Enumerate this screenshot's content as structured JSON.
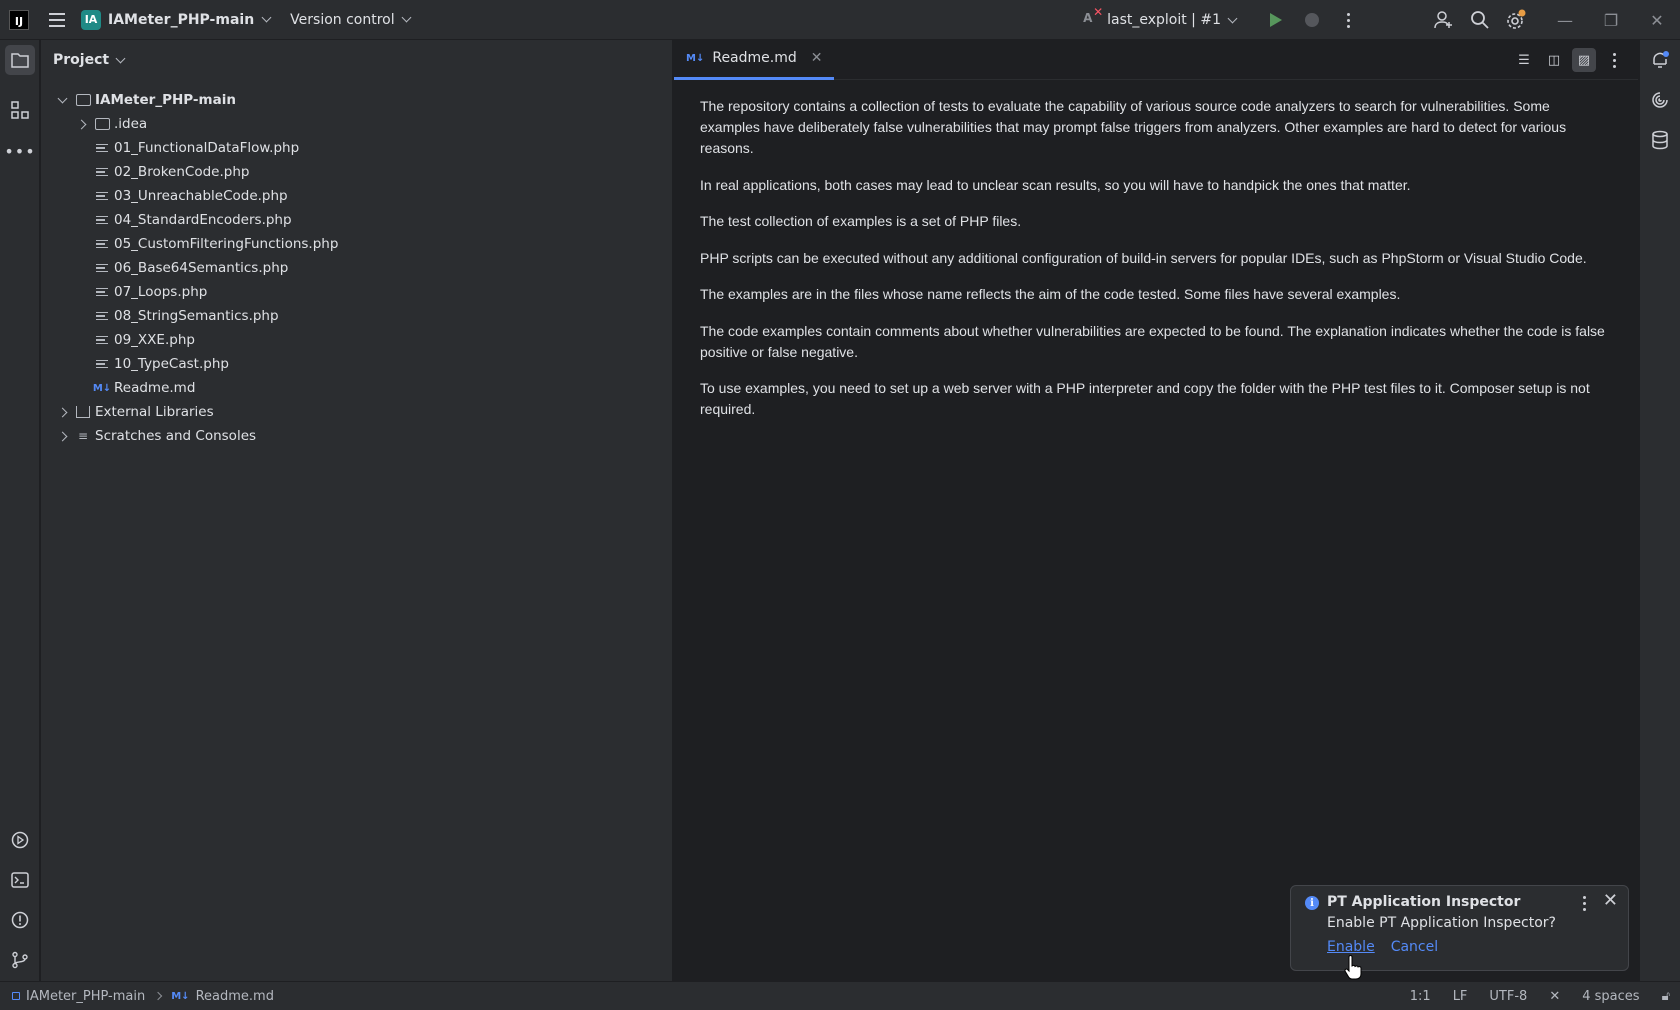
{
  "titlebar": {
    "logo": "IJ",
    "project_badge": "IA",
    "project_name": "IAMeter_PHP-main",
    "version_control": "Version control",
    "run_config": "last_exploit | #1"
  },
  "project_panel": {
    "title": "Project",
    "tree": [
      {
        "label": "IAMeter_PHP-main",
        "type": "root"
      },
      {
        "label": ".idea",
        "type": "folder"
      },
      {
        "label": "01_FunctionalDataFlow.php",
        "type": "file"
      },
      {
        "label": "02_BrokenCode.php",
        "type": "file"
      },
      {
        "label": "03_UnreachableCode.php",
        "type": "file"
      },
      {
        "label": "04_StandardEncoders.php",
        "type": "file"
      },
      {
        "label": "05_CustomFilteringFunctions.php",
        "type": "file"
      },
      {
        "label": "06_Base64Semantics.php",
        "type": "file"
      },
      {
        "label": "07_Loops.php",
        "type": "file"
      },
      {
        "label": "08_StringSemantics.php",
        "type": "file"
      },
      {
        "label": "09_XXE.php",
        "type": "file"
      },
      {
        "label": "10_TypeCast.php",
        "type": "file"
      },
      {
        "label": "Readme.md",
        "type": "md"
      },
      {
        "label": "External Libraries",
        "type": "lib"
      },
      {
        "label": "Scratches and Consoles",
        "type": "scratch"
      }
    ]
  },
  "editor": {
    "tab_icon": "M↓",
    "tab_label": "Readme.md",
    "paragraphs": [
      "The repository contains a collection of tests to evaluate the capability of various source code analyzers to search for vulnerabilities. Some examples have deliberately false vulnerabilities that may prompt false triggers from analyzers. Other examples are hard to detect for various reasons.",
      "In real applications, both cases may lead to unclear scan results, so you will have to handpick the ones that matter.",
      "The test collection of examples is a set of PHP files.",
      "PHP scripts can be executed without any additional configuration of build-in servers for popular IDEs, such as PhpStorm or Visual Studio Code.",
      "The examples are in the files whose name reflects the aim of the code tested. Some files have several examples.",
      "The code examples contain comments about whether vulnerabilities are expected to be found. The explanation indicates whether the code is false positive or false negative.",
      "To use examples, you need to set up a web server with a PHP interpreter and copy the folder with the PHP test files to it. Composer setup is not required."
    ]
  },
  "notification": {
    "title": "PT Application Inspector",
    "body": "Enable PT Application Inspector?",
    "enable": "Enable",
    "cancel": "Cancel"
  },
  "statusbar": {
    "project": "IAMeter_PHP-main",
    "file": "Readme.md",
    "position": "1:1",
    "line_sep": "LF",
    "encoding": "UTF-8",
    "indent": "4 spaces"
  },
  "colors": {
    "accent": "#548af7",
    "run_green": "#57965c",
    "project_badge": "#1f8a86"
  }
}
